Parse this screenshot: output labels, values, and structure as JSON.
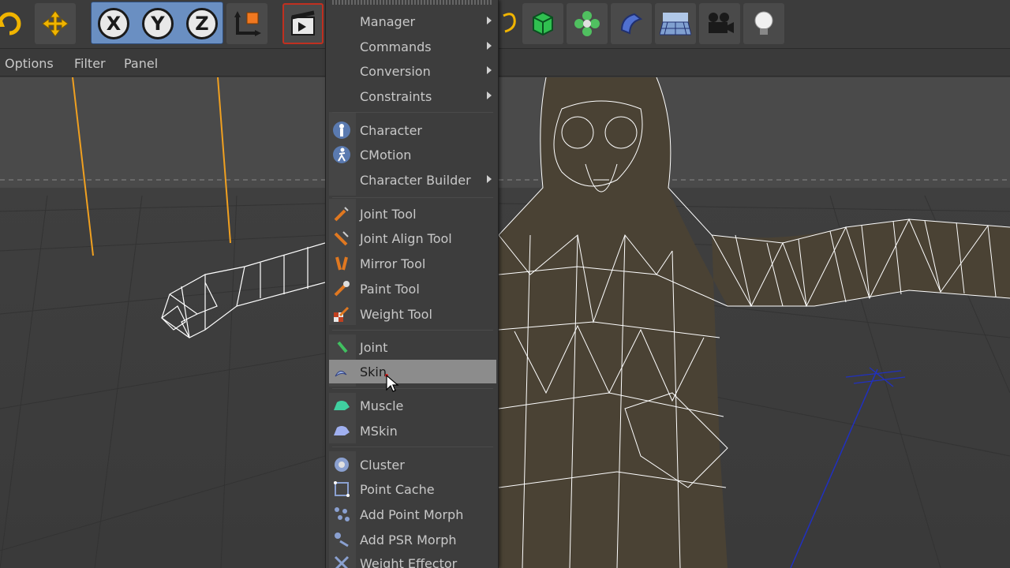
{
  "menubar": {
    "items": [
      "Options",
      "Filter",
      "Panel"
    ]
  },
  "toolbar": {
    "buttons": [
      "rotate-icon",
      "move-icon",
      "x-axis-icon",
      "y-axis-icon",
      "z-axis-icon",
      "coordinate-system-icon",
      "render-icon",
      "spline-icon",
      "cube-icon",
      "subdivision-icon",
      "deformer-icon",
      "floor-icon",
      "camera-icon",
      "light-icon"
    ],
    "xyz": [
      "X",
      "Y",
      "Z"
    ]
  },
  "menu": {
    "items": [
      {
        "label": "Manager",
        "submenu": true
      },
      {
        "label": "Commands",
        "submenu": true
      },
      {
        "label": "Conversion",
        "submenu": true
      },
      {
        "label": "Constraints",
        "submenu": true
      },
      {
        "label": "Character",
        "icon": "character-icon"
      },
      {
        "label": "CMotion",
        "icon": "cmotion-icon"
      },
      {
        "label": "Character Builder",
        "submenu": true
      },
      {
        "label": "Joint Tool",
        "icon": "joint-tool-icon"
      },
      {
        "label": "Joint Align Tool",
        "icon": "joint-align-tool-icon"
      },
      {
        "label": "Mirror Tool",
        "icon": "mirror-tool-icon"
      },
      {
        "label": "Paint Tool",
        "icon": "paint-tool-icon"
      },
      {
        "label": "Weight Tool",
        "icon": "weight-tool-icon"
      },
      {
        "label": "Joint",
        "icon": "joint-icon"
      },
      {
        "label": "Skin",
        "icon": "skin-icon",
        "highlighted": true
      },
      {
        "label": "Muscle",
        "icon": "muscle-icon"
      },
      {
        "label": "MSkin",
        "icon": "mskin-icon"
      },
      {
        "label": "Cluster",
        "icon": "cluster-icon"
      },
      {
        "label": "Point Cache",
        "icon": "point-cache-icon"
      },
      {
        "label": "Add Point Morph",
        "icon": "add-point-morph-icon"
      },
      {
        "label": "Add PSR Morph",
        "icon": "add-psr-morph-icon"
      },
      {
        "label": "Weight Effector",
        "icon": "weight-effector-icon"
      }
    ]
  },
  "colors": {
    "accent_blue": "#6a8fc2",
    "menu_bg": "#3d3d3d",
    "highlight": "#8c8c8c",
    "text": "#c8c8c8",
    "wire": "#ffffff",
    "bone": "#f0a020"
  }
}
